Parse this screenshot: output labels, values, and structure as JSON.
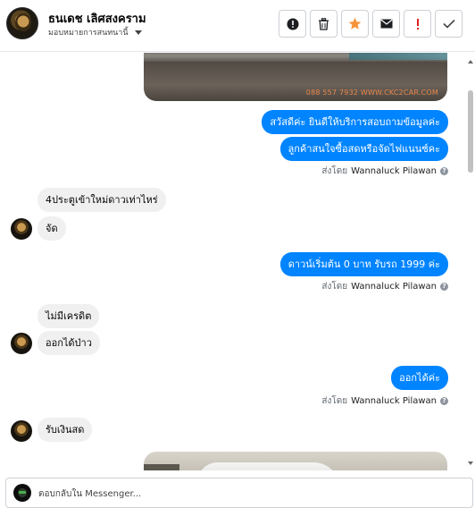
{
  "header": {
    "contact_name": "ธนเดช เลิศสงคราม",
    "assign_label": "มอบหมายการสนทนานี้",
    "actions": [
      {
        "name": "report-icon",
        "label": "!"
      },
      {
        "name": "trash-icon",
        "label": ""
      },
      {
        "name": "star-icon",
        "label": ""
      },
      {
        "name": "mail-icon",
        "label": ""
      },
      {
        "name": "spam-icon",
        "label": "!"
      },
      {
        "name": "check-icon",
        "label": ""
      }
    ],
    "colors": {
      "star": "#f7923a",
      "spam": "#e02020"
    }
  },
  "thread": {
    "top_photo_watermark": "088 557 7932 WWW.CKC2CAR.COM",
    "messages_out_1": [
      "สวัสดีค่ะ  ยินดีให้บริการสอบถามข้อมูลค่ะ",
      "ลูกค้าสนใจซื้อสดหรือจัดไฟแนนซ์คะ"
    ],
    "sent_by_label": "ส่งโดย",
    "sender_name": "Wannaluck Pilawan",
    "help_glyph": "?",
    "messages_in_1": [
      "4ประตูเข้าใหม่ดาวเท่าไหร่",
      "จัด"
    ],
    "messages_out_2": [
      "ดาวน์เริ่มต้น 0 บาท รับรถ 1999 ค่ะ"
    ],
    "messages_in_2": [
      "ไม่มีเครดิต",
      "ออกได้ป่าว"
    ],
    "messages_out_3": [
      "ออกได้ค่ะ"
    ],
    "messages_in_3": [
      "รับเงินสด"
    ]
  },
  "composer": {
    "placeholder": "ตอบกลับใน Messenger..."
  },
  "colors": {
    "outgoing_bubble": "#0084ff",
    "incoming_bubble": "#f0f0f0"
  }
}
